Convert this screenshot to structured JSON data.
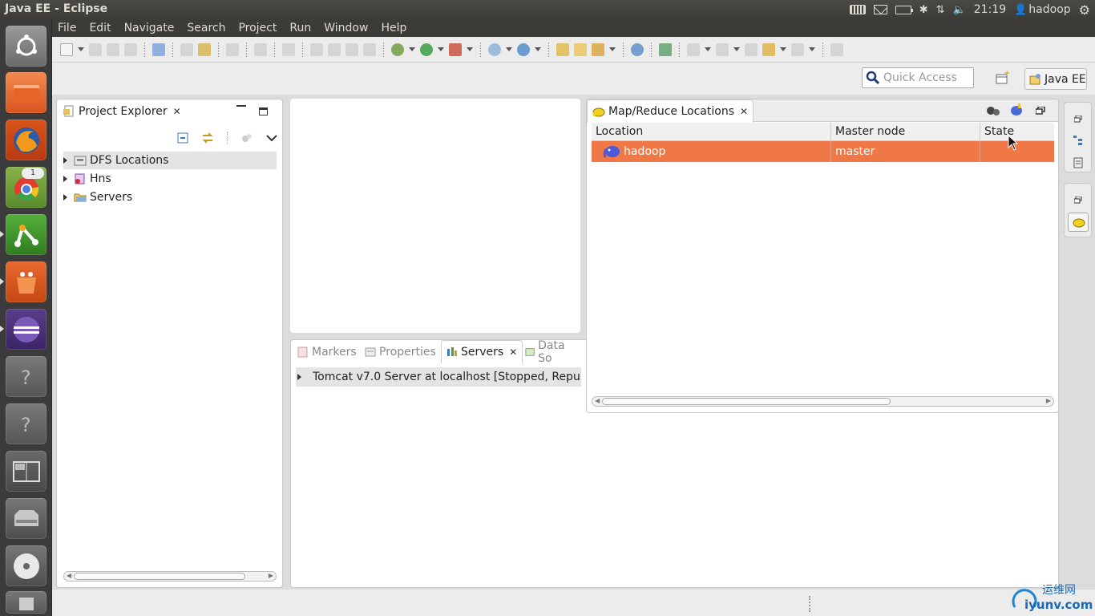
{
  "window": {
    "title": "Java EE - Eclipse"
  },
  "tray": {
    "clock": "21:19",
    "user": "hadoop"
  },
  "launcher": {
    "chrome_badge": "1"
  },
  "menu": [
    "File",
    "Edit",
    "Navigate",
    "Search",
    "Project",
    "Run",
    "Window",
    "Help"
  ],
  "quick_access": {
    "placeholder": "Quick Access"
  },
  "perspective": {
    "label": "Java EE"
  },
  "project_explorer": {
    "tab_label": "Project Explorer",
    "items": [
      {
        "label": "DFS Locations"
      },
      {
        "label": "Hns"
      },
      {
        "label": "Servers"
      }
    ]
  },
  "bottom_panel": {
    "tabs": [
      "Markers",
      "Properties",
      "Servers",
      "Data So"
    ],
    "active_tab": "Servers",
    "server_row": "Tomcat v7.0 Server at localhost  [Stopped, Repub"
  },
  "mr_panel": {
    "tab_label": "Map/Reduce Locations",
    "columns": [
      "Location",
      "Master node",
      "State"
    ],
    "rows": [
      {
        "location": "hadoop",
        "master": "master",
        "state": ""
      }
    ]
  },
  "watermark": {
    "cn": "运维网",
    "url": "iyunv.com"
  },
  "colors": {
    "selection": "#f07746",
    "panel_bg": "#3c3b37"
  }
}
